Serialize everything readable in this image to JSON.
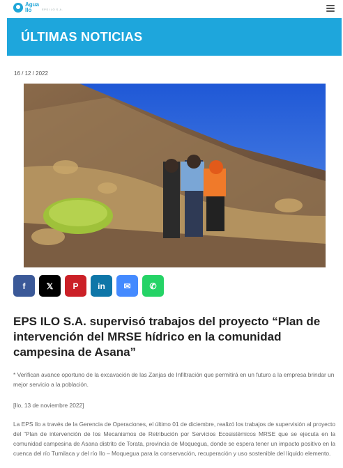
{
  "header": {
    "logo_line1": "Agua",
    "logo_line2": "Ilo",
    "logo_sub": "EPS ILO S.A.",
    "menu_icon": "hamburger-icon"
  },
  "banner": {
    "title": "ÚLTIMAS NOTICIAS"
  },
  "article": {
    "date": "16 / 12 / 2022",
    "headline": "EPS ILO S.A. supervisó trabajos del proyecto “Plan de intervención del MRSE hídrico en la comunidad campesina de Asana”",
    "lead": "* Verifican avance oportuno de la excavación de las Zanjas de Infiltración que permitirá en un futuro a la empresa brindar un mejor servicio a la población.",
    "dateline": "[Ilo, 13 de noviembre 2022]",
    "body": "La EPS Ilo a través de la Gerencia de Operaciones, el último 01 de diciembre, realizó los trabajos de supervisión al proyecto del “Plan de intervención de los Mecanismos de Retribución por Servicios Ecosistémicos MRSE que se ejecuta en la comunidad campesina de Asana distrito de Torata, provincia de Moquegua, donde se espera tener un impacto positivo en la cuenca del río Tumilaca y del río Ilo – Moquegua para la conservación, recuperación y uso sostenible del líquido elemento."
  },
  "share_buttons": [
    {
      "name": "facebook",
      "icon": "facebook-icon",
      "glyph": "f",
      "color": "#3b5998"
    },
    {
      "name": "x",
      "icon": "x-icon",
      "glyph": "𝕏",
      "color": "#000000"
    },
    {
      "name": "pinterest",
      "icon": "pinterest-icon",
      "glyph": "P",
      "color": "#cb2027"
    },
    {
      "name": "linkedin",
      "icon": "linkedin-icon",
      "glyph": "in",
      "color": "#0e76a8"
    },
    {
      "name": "messenger",
      "icon": "messenger-icon",
      "glyph": "✉",
      "color": "#448aff"
    },
    {
      "name": "whatsapp",
      "icon": "whatsapp-icon",
      "glyph": "✆",
      "color": "#25d366"
    }
  ]
}
